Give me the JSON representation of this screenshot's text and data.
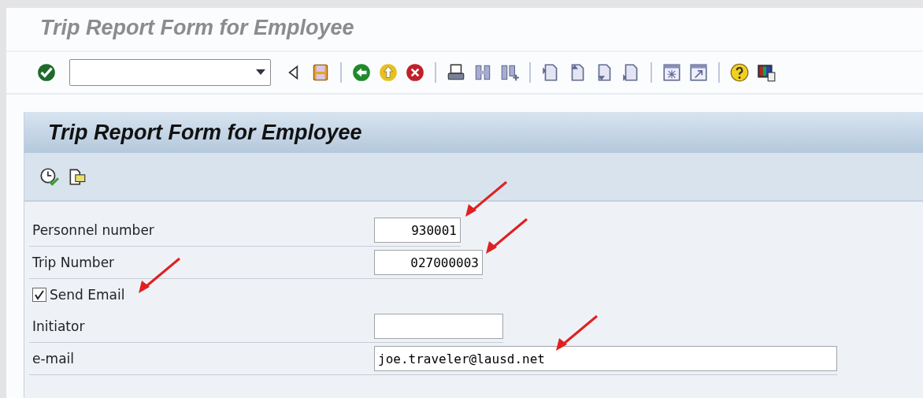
{
  "window": {
    "title": "Trip Report Form for Employee"
  },
  "screen": {
    "title": "Trip Report Form for Employee"
  },
  "fields": [
    {
      "kind": "number",
      "label": "Personnel number",
      "value": "930001"
    },
    {
      "kind": "number",
      "label": "Trip Number",
      "value": "027000003"
    },
    {
      "kind": "checkbox",
      "label": "Send Email",
      "checked": true
    },
    {
      "kind": "text",
      "label": "Initiator"
    },
    {
      "kind": "text",
      "label": "e-mail",
      "value": "joe.traveler@lausd.net"
    }
  ]
}
